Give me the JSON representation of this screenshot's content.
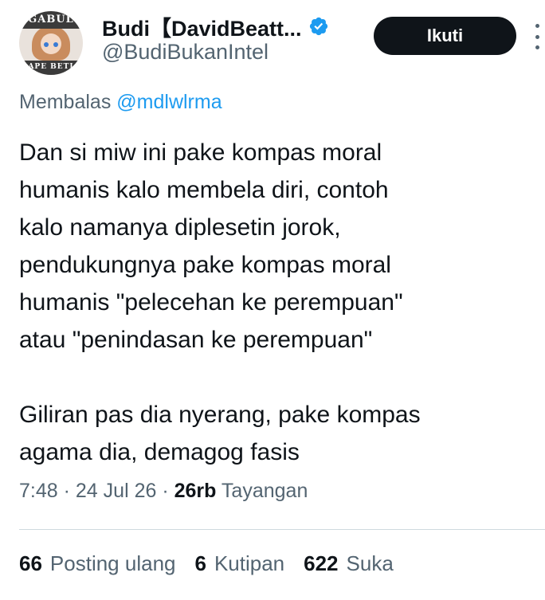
{
  "author": {
    "display_name": "Budi【DavidBeatt...",
    "handle": "@BudiBukanIntel",
    "avatar": {
      "banner_top": "GABUL",
      "banner_bottom": "APE BETI"
    },
    "verified_icon": "verified-badge-icon"
  },
  "actions": {
    "follow_label": "Ikuti",
    "more_icon": "more-vertical-icon"
  },
  "reply": {
    "prefix": "Membalas",
    "handle": "@mdlwlrma"
  },
  "tweet": {
    "lines": [
      "Dan si miw ini pake kompas moral",
      "humanis kalo membela diri, contoh",
      "kalo namanya diplesetin jorok,",
      "pendukungnya pake kompas moral",
      "humanis \"pelecehan ke perempuan\"",
      "atau \"penindasan ke perempuan\"",
      "",
      "Giliran pas dia nyerang, pake kompas",
      "agama dia, demagog fasis"
    ]
  },
  "meta": {
    "time": "7:48",
    "separator": "·",
    "date": "24 Jul 26",
    "views_count": "26rb",
    "views_label": "Tayangan"
  },
  "stats": {
    "reposts_count": "66",
    "reposts_label": "Posting ulang",
    "quotes_count": "6",
    "quotes_label": "Kutipan",
    "likes_count": "622",
    "likes_label": "Suka"
  },
  "colors": {
    "text": "#0f1419",
    "secondary": "#536471",
    "accent": "#1d9bf0",
    "divider": "#cfd9de",
    "follow_bg": "#0f1419"
  }
}
